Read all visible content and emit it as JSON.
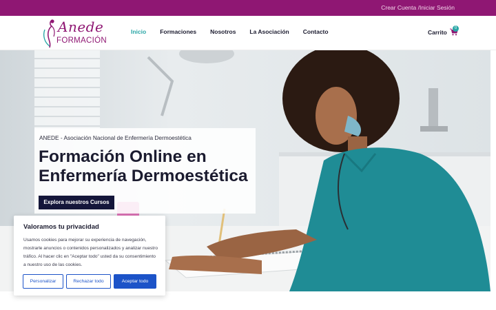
{
  "topbar": {
    "account_link": "Crear Cuenta /Iniciar Sesión"
  },
  "logo": {
    "main": "Anede",
    "sub": "FORMACIÓN"
  },
  "nav": {
    "items": [
      {
        "label": "Inicio",
        "active": true
      },
      {
        "label": "Formaciones"
      },
      {
        "label": "Nosotros"
      },
      {
        "label": "La Asociación"
      },
      {
        "label": "Contacto"
      }
    ]
  },
  "cart": {
    "label": "Carrito",
    "count": "0"
  },
  "hero": {
    "kicker": "ANEDE - Asociación Nacional de Enfermería Dermoestética",
    "title_line1": "Formación Online en",
    "title_line2": "Enfermería Dermoestética",
    "cta": "Explora nuestros Cursos"
  },
  "cookie": {
    "title": "Valoramos tu privacidad",
    "text": "Usamos cookies para mejorar su experiencia de navegación, mostrarle anuncios o contenidos personalizados y analizar nuestro tráfico. Al hacer clic en \"Aceptar todo\" usted da su consentimiento a nuestro uso de las cookies.",
    "btn_customize": "Personalizar",
    "btn_reject": "Rechazar todo",
    "btn_accept": "Aceptar todo"
  },
  "colors": {
    "brand_magenta": "#8f1773",
    "accent_teal": "#2aa6a6",
    "navy": "#14163a",
    "cookie_blue": "#1c53c8"
  }
}
